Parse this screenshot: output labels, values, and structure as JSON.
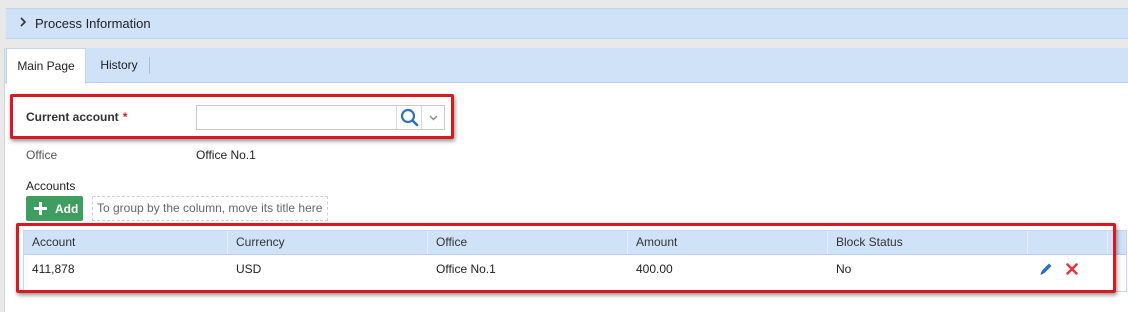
{
  "process": {
    "chevron_icon": "chevron-right-icon",
    "title": "Process Information"
  },
  "tabs": [
    {
      "label": "Main Page"
    },
    {
      "label": "History"
    }
  ],
  "form": {
    "current_account": {
      "label": "Current account",
      "required_mark": "*",
      "value": "",
      "search_icon": "search-icon",
      "dropdown_icon": "chevron-down-icon"
    },
    "office": {
      "label": "Office",
      "value": "Office No.1"
    }
  },
  "accounts": {
    "title": "Accounts",
    "add_label": "Add",
    "group_hint": "To group by the column, move its title here",
    "columns": [
      {
        "label": "Account"
      },
      {
        "label": "Currency"
      },
      {
        "label": "Office"
      },
      {
        "label": "Amount"
      },
      {
        "label": "Block Status"
      },
      {
        "label": ""
      }
    ],
    "rows": [
      {
        "account": "411,878",
        "currency": "USD",
        "office": "Office No.1",
        "amount": "400.00",
        "block_status": "No"
      }
    ]
  },
  "colors": {
    "highlight": "#d71921",
    "header_blue": "#cfe2f8",
    "add_green": "#3e9e5f",
    "edit_blue": "#2e73b8",
    "delete_red": "#e0383e"
  }
}
